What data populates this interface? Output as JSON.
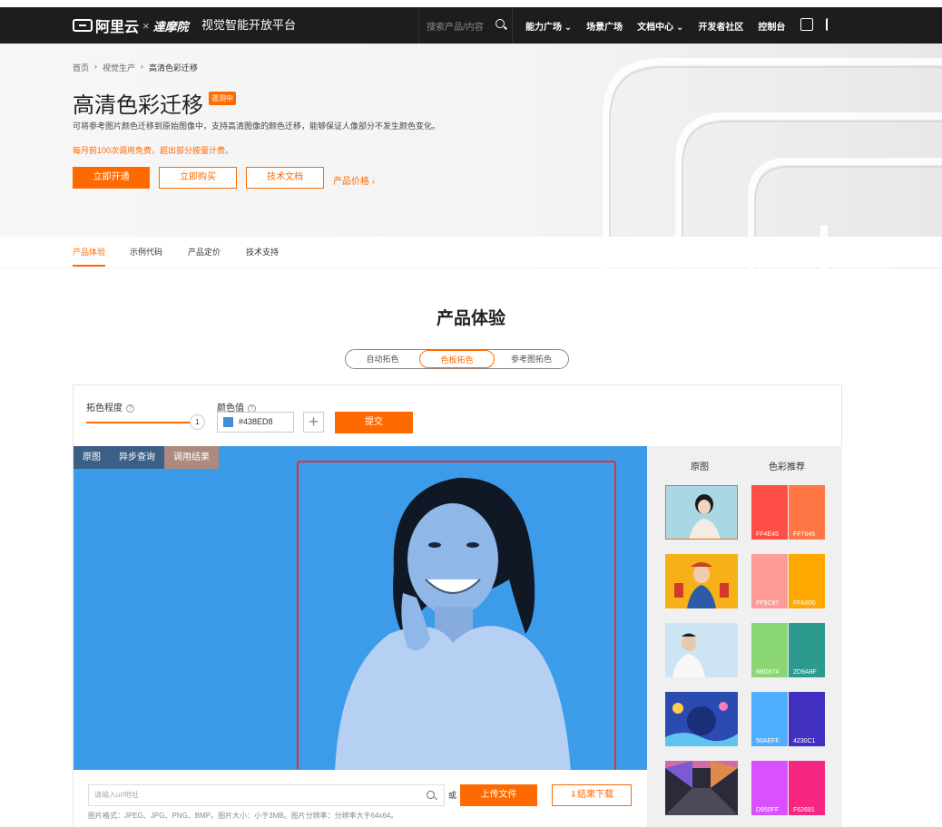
{
  "nav": {
    "logo_text": "阿里云",
    "partner_text": "達摩院",
    "platform_title": "视觉智能开放平台",
    "search_placeholder": "搜索产品/内容",
    "links": [
      "能力广场",
      "场景广场",
      "文档中心",
      "开发者社区",
      "控制台"
    ]
  },
  "hero": {
    "breadcrumb": [
      "首页",
      "视觉生产",
      "高清色彩迁移"
    ],
    "title": "高清色彩迁移",
    "badge": "邀测中",
    "description": "可将参考图片颜色迁移到原始图像中，支持高清图像的颜色迁移，能够保证人像部分不发生颜色变化。",
    "free_note": "每月前100次调用免费，超出部分按量计费。",
    "buttons": {
      "activate": "立即开通",
      "buy": "立即购买",
      "docs": "技术文档",
      "price": "产品价格"
    }
  },
  "tabs": [
    "产品体验",
    "示例代码",
    "产品定价",
    "技术支持"
  ],
  "experience": {
    "section_title": "产品体验",
    "modes": [
      "自动拓色",
      "色板拓色",
      "参考图拓色"
    ],
    "active_mode": "色板拓色",
    "controls": {
      "degree_label": "拓色程度",
      "degree_value": "1",
      "color_label": "颜色值",
      "color_value": "#438ED8",
      "submit": "提交"
    },
    "stage_tabs": [
      "原图",
      "异步查询",
      "调用结果"
    ],
    "side": {
      "original_header": "原图",
      "recommend_header": "色彩推荐",
      "palettes": [
        {
          "colors": [
            "#FF4E45",
            "#FF7645"
          ],
          "labels": [
            "FF4E45",
            "FF7645"
          ]
        },
        {
          "colors": [
            "#FF9C97",
            "#FFA800"
          ],
          "labels": [
            "FF9C97",
            "FFA800"
          ]
        },
        {
          "colors": [
            "#8BD674",
            "#2D9A8F"
          ],
          "labels": [
            "8BD674",
            "2D9A8F"
          ]
        },
        {
          "colors": [
            "#50AEFF",
            "#4230C1"
          ],
          "labels": [
            "50AEFF",
            "4230C1"
          ]
        },
        {
          "colors": [
            "#D950FF",
            "#F62681"
          ],
          "labels": [
            "D950FF",
            "F62681"
          ]
        }
      ]
    },
    "upload": {
      "url_placeholder": "请输入url地址",
      "or": "或",
      "upload_button": "上传文件",
      "download_button": "⇓结果下载",
      "format_note": "图片格式：JPEG、JPG、PNG、BMP。图片大小：小于3MB。图片分辨率：分辨率大于64x64。"
    }
  },
  "colors": {
    "accent": "#ff6a00",
    "nav_bg": "#1d1d1d",
    "stage_bg": "#3c9be9"
  }
}
